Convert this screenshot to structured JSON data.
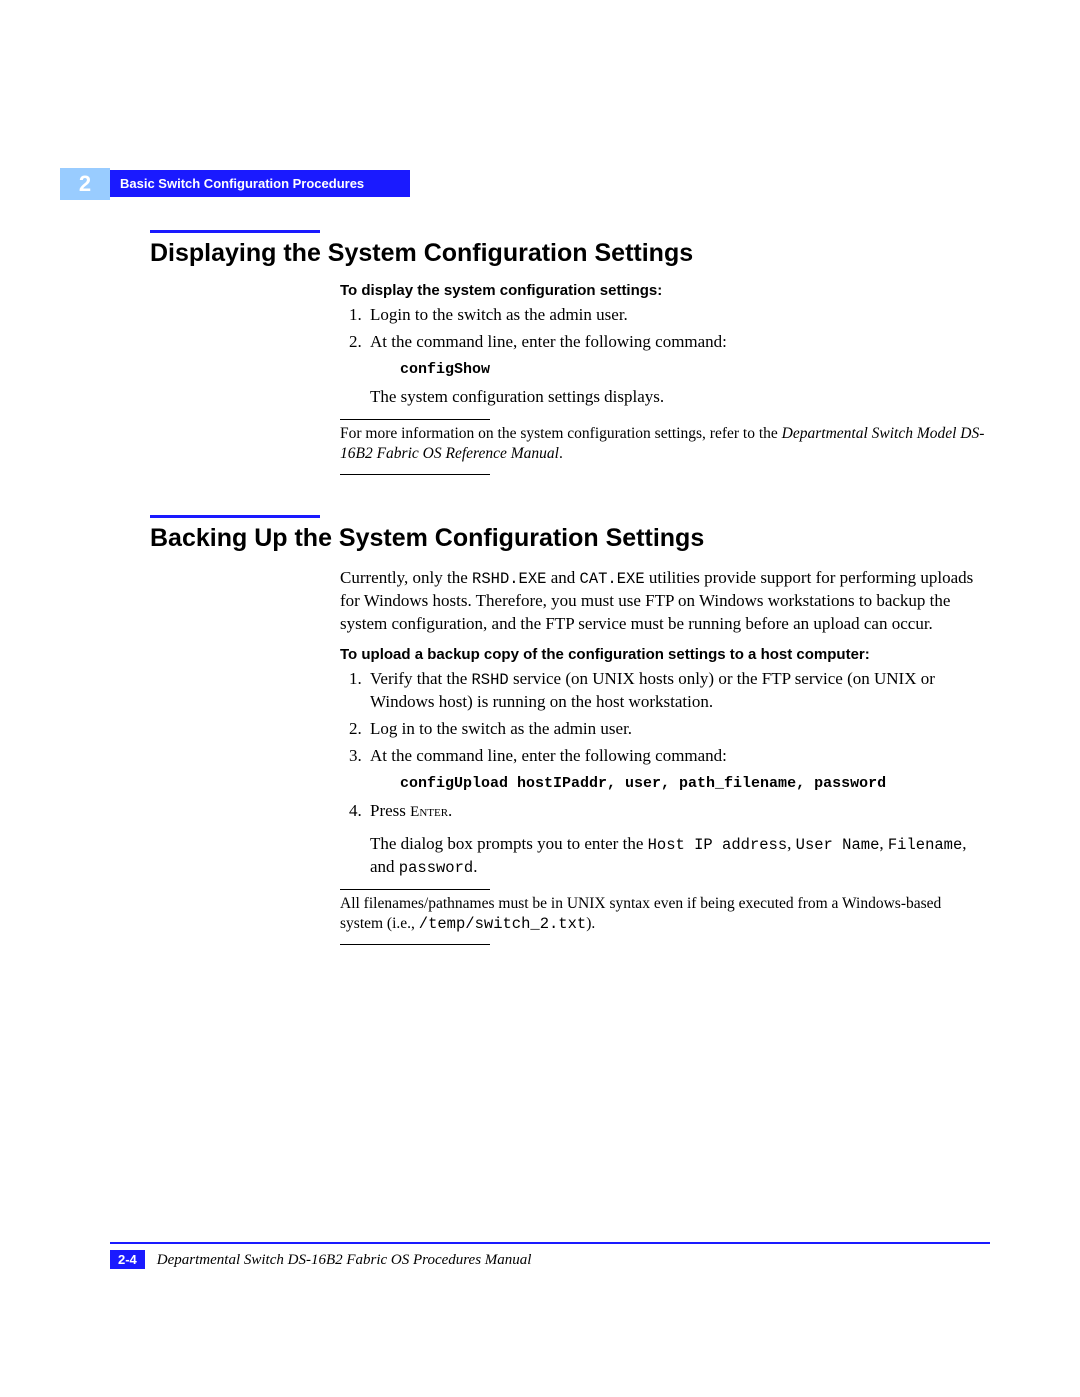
{
  "chapter": {
    "number": "2",
    "header": "Basic Switch Configuration Procedures"
  },
  "section1": {
    "title": "Displaying the System Configuration Settings",
    "instruction_heading": "To display the system configuration settings:",
    "steps": {
      "s1": "Login to the switch as the admin user.",
      "s2": "At the command line, enter the following command:"
    },
    "command": "configShow",
    "result": "The system configuration settings displays.",
    "note_prefix": "For more information on the system configuration settings, refer to the ",
    "note_italic": "Departmental Switch Model DS-16B2 Fabric OS Reference Manual",
    "note_suffix": "."
  },
  "section2": {
    "title": "Backing Up the System Configuration Settings",
    "intro_pre": "Currently, only the ",
    "intro_code1": "RSHD.EXE",
    "intro_mid1": " and ",
    "intro_code2": "CAT.EXE",
    "intro_post": " utilities provide support for performing uploads for Windows hosts. Therefore, you must use FTP on Windows workstations to backup the system configuration, and the FTP service must be running before an upload can occur.",
    "instruction_heading": "To upload a backup copy of the configuration settings to a host computer:",
    "step1_pre": "Verify that the ",
    "step1_code": "RSHD",
    "step1_post": " service (on UNIX hosts only) or the FTP service (on UNIX or Windows host) is running on the host workstation.",
    "step2": "Log in to the switch as the admin user.",
    "step3": "At the command line, enter the following command:",
    "command": "configUpload hostIPaddr, user, path_filename, password",
    "step4_pre": "Press ",
    "step4_key": "Enter",
    "step4_post": ".",
    "dialog_pre": "The dialog box prompts you to enter the ",
    "dialog_c1": "Host IP address",
    "dialog_m1": ", ",
    "dialog_c2": "User Name",
    "dialog_m2": ", ",
    "dialog_c3": "Filename",
    "dialog_m3": ", and ",
    "dialog_c4": "password",
    "dialog_post": ".",
    "note_pre": "All filenames/pathnames must be in UNIX syntax even if being executed from a Windows-based system (i.e., ",
    "note_code": "/temp/switch_2.txt",
    "note_post": ")."
  },
  "footer": {
    "page_number": "2-4",
    "book_title": "Departmental Switch DS-16B2 Fabric OS Procedures Manual"
  }
}
